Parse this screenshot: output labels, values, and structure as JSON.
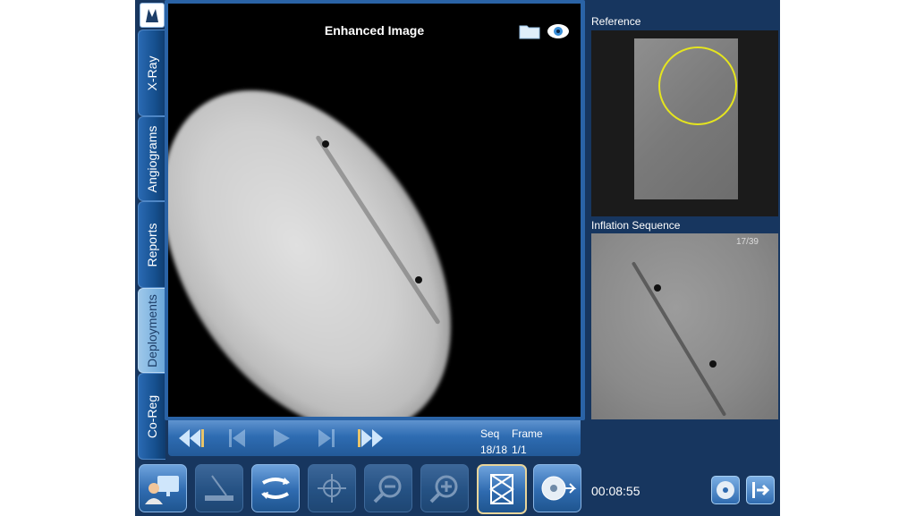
{
  "tabs": [
    {
      "label": "X-Ray",
      "active": false
    },
    {
      "label": "Angiograms",
      "active": false
    },
    {
      "label": "Reports",
      "active": false
    },
    {
      "label": "Deployments",
      "active": true
    },
    {
      "label": "Co-Reg",
      "active": false
    }
  ],
  "main_panel": {
    "title": "Enhanced Image",
    "icons": [
      "folder-icon",
      "eye-icon"
    ]
  },
  "transport": {
    "seq_label": "Seq",
    "frame_label": "Frame",
    "seq_value": "18/18",
    "frame_value": "1/1",
    "buttons": [
      "first-icon",
      "previous-icon",
      "play-icon",
      "next-icon",
      "last-icon"
    ]
  },
  "reference": {
    "label": "Reference"
  },
  "inflation_sequence": {
    "label": "Inflation Sequence",
    "frame_counter": "17/39"
  },
  "timer": "00:08:55",
  "toolbar": {
    "tools": [
      {
        "icon": "user-monitor-icon",
        "enabled": true,
        "selected": false
      },
      {
        "icon": "catheter-icon",
        "enabled": false,
        "selected": false
      },
      {
        "icon": "swap-icon",
        "enabled": true,
        "selected": false
      },
      {
        "icon": "crosshair-icon",
        "enabled": false,
        "selected": false
      },
      {
        "icon": "zoom-out-icon",
        "enabled": false,
        "selected": false
      },
      {
        "icon": "zoom-in-icon",
        "enabled": false,
        "selected": false
      },
      {
        "icon": "stent-icon",
        "enabled": true,
        "selected": true
      },
      {
        "icon": "disc-export-icon",
        "enabled": true,
        "selected": false
      }
    ]
  },
  "colors": {
    "background": "#17365f",
    "accent": "#2a63a6",
    "active_tab": "#9ec8ea",
    "reference_circle": "#e5e51e",
    "selected_outline": "#e8d49a"
  }
}
